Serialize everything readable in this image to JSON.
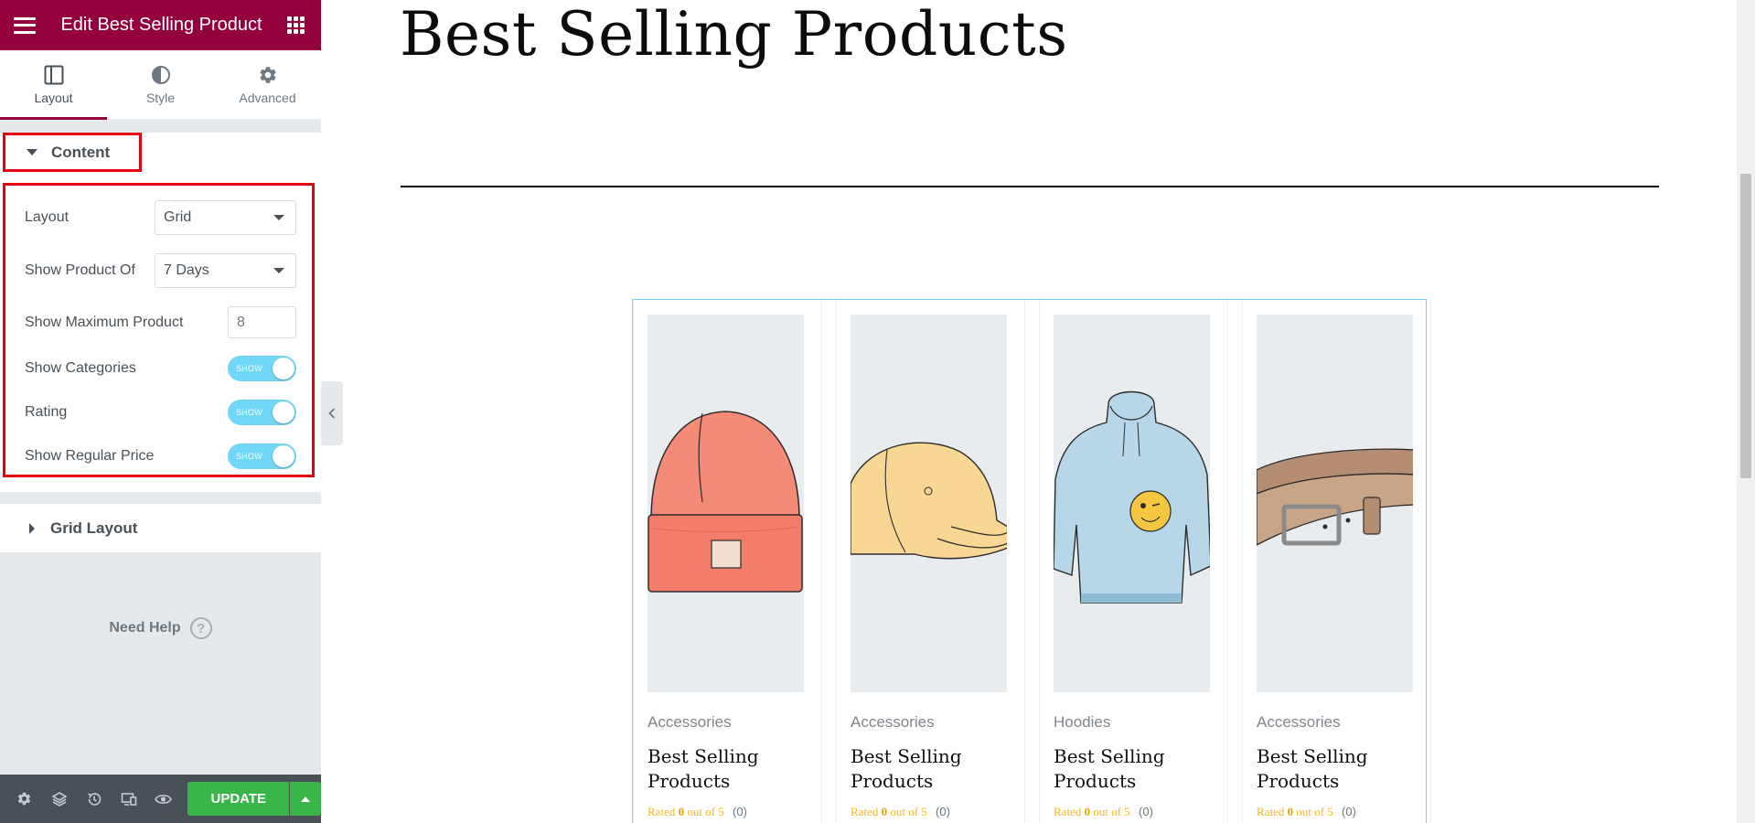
{
  "panel": {
    "title": "Edit Best Selling Product",
    "tabs": [
      {
        "label": "Layout",
        "icon": "layout-icon",
        "active": true
      },
      {
        "label": "Style",
        "icon": "half-circle-icon",
        "active": false
      },
      {
        "label": "Advanced",
        "icon": "gear-icon",
        "active": false
      }
    ],
    "content_section": {
      "label": "Content",
      "controls": {
        "layout": {
          "label": "Layout",
          "value": "Grid"
        },
        "show_product_of": {
          "label": "Show Product Of",
          "value": "7 Days"
        },
        "max_product": {
          "label": "Show Maximum Product",
          "value": "8"
        },
        "show_categories": {
          "label": "Show Categories",
          "toggle_text": "SHOW",
          "on": true
        },
        "rating": {
          "label": "Rating",
          "toggle_text": "SHOW",
          "on": true
        },
        "regular_price": {
          "label": "Show Regular Price",
          "toggle_text": "SHOW",
          "on": true
        }
      }
    },
    "grid_section": {
      "label": "Grid Layout"
    },
    "need_help": "Need Help",
    "help_glyph": "?",
    "footer": {
      "update_label": "UPDATE"
    }
  },
  "colors": {
    "brand": "#93003c",
    "toggle_on": "#71d7f7",
    "update_green": "#39b54a",
    "highlight_red": "#e50010",
    "rating_gold": "#f2b827"
  },
  "preview": {
    "title": "Best Selling Products",
    "products": [
      {
        "category": "Accessories",
        "name": "Best Selling Products",
        "rating_prefix": "Rated",
        "rating_value": "0",
        "rating_suffix": "out of 5",
        "review_count": "(0)",
        "image": "beanie"
      },
      {
        "category": "Accessories",
        "name": "Best Selling Products",
        "rating_prefix": "Rated",
        "rating_value": "0",
        "rating_suffix": "out of 5",
        "review_count": "(0)",
        "image": "cap"
      },
      {
        "category": "Hoodies",
        "name": "Best Selling Products",
        "rating_prefix": "Rated",
        "rating_value": "0",
        "rating_suffix": "out of 5",
        "review_count": "(0)",
        "image": "hoodie"
      },
      {
        "category": "Accessories",
        "name": "Best Selling Products",
        "rating_prefix": "Rated",
        "rating_value": "0",
        "rating_suffix": "out of 5",
        "review_count": "(0)",
        "image": "belt"
      }
    ]
  }
}
